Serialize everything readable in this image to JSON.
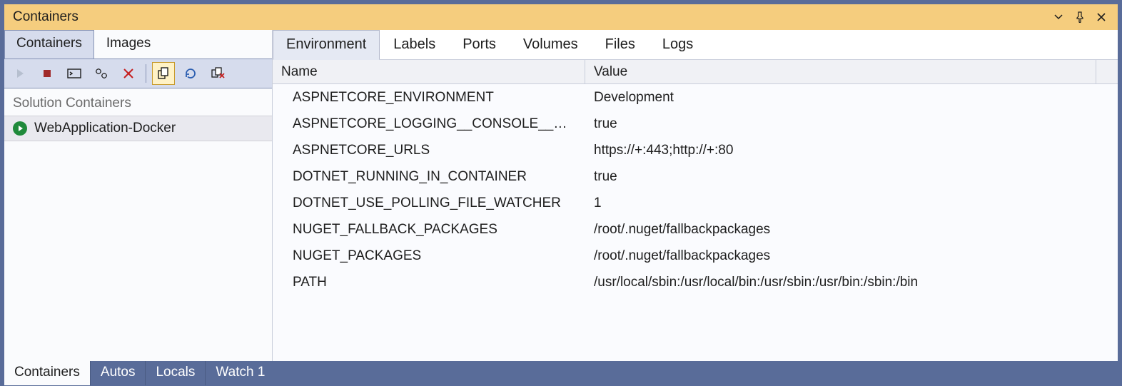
{
  "window": {
    "title": "Containers"
  },
  "leftTabs": {
    "containers": "Containers",
    "images": "Images",
    "activeIndex": 0
  },
  "toolbar": {
    "icons": [
      "play-icon",
      "stop-icon",
      "terminal-icon",
      "settings-icon",
      "delete-icon",
      "copy-icon",
      "refresh-icon",
      "prune-icon"
    ],
    "activeIndex": 5
  },
  "sidebar": {
    "groupLabel": "Solution Containers",
    "items": [
      {
        "label": "WebApplication-Docker",
        "running": true
      }
    ]
  },
  "detailTabs": {
    "labels": [
      "Environment",
      "Labels",
      "Ports",
      "Volumes",
      "Files",
      "Logs"
    ],
    "activeIndex": 0
  },
  "grid": {
    "headers": {
      "name": "Name",
      "value": "Value"
    },
    "rows": [
      {
        "name": "ASPNETCORE_ENVIRONMENT",
        "value": "Development"
      },
      {
        "name": "ASPNETCORE_LOGGING__CONSOLE__DISA…",
        "value": "true"
      },
      {
        "name": "ASPNETCORE_URLS",
        "value": "https://+:443;http://+:80"
      },
      {
        "name": "DOTNET_RUNNING_IN_CONTAINER",
        "value": "true"
      },
      {
        "name": "DOTNET_USE_POLLING_FILE_WATCHER",
        "value": "1"
      },
      {
        "name": "NUGET_FALLBACK_PACKAGES",
        "value": "/root/.nuget/fallbackpackages"
      },
      {
        "name": "NUGET_PACKAGES",
        "value": "/root/.nuget/fallbackpackages"
      },
      {
        "name": "PATH",
        "value": "/usr/local/sbin:/usr/local/bin:/usr/sbin:/usr/bin:/sbin:/bin"
      }
    ]
  },
  "bottomTabs": {
    "labels": [
      "Containers",
      "Autos",
      "Locals",
      "Watch 1"
    ],
    "activeIndex": 0
  }
}
